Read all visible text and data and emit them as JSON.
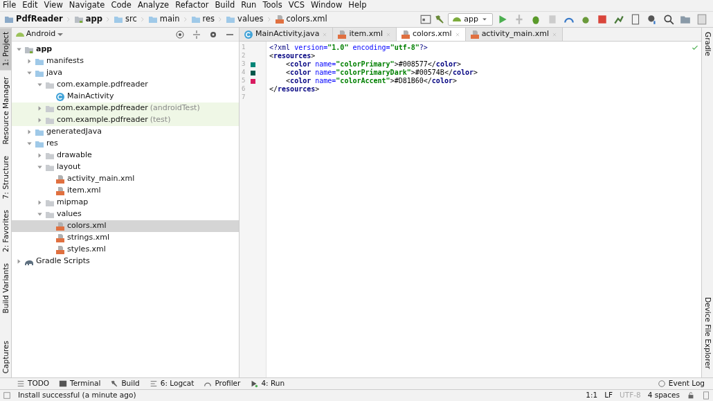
{
  "menu": [
    "File",
    "Edit",
    "View",
    "Navigate",
    "Code",
    "Analyze",
    "Refactor",
    "Build",
    "Run",
    "Tools",
    "VCS",
    "Window",
    "Help"
  ],
  "breadcrumb": [
    {
      "label": "PdfReader",
      "kind": "project"
    },
    {
      "label": "app",
      "kind": "module"
    },
    {
      "label": "src",
      "kind": "folder"
    },
    {
      "label": "main",
      "kind": "folder"
    },
    {
      "label": "res",
      "kind": "folder"
    },
    {
      "label": "values",
      "kind": "folder"
    },
    {
      "label": "colors.xml",
      "kind": "xml"
    }
  ],
  "run_config": "app",
  "left_stripe": [
    {
      "label": "1: Project",
      "selected": true
    },
    {
      "label": "Resource Manager",
      "selected": false
    },
    {
      "label": "7: Structure",
      "selected": false
    },
    {
      "label": "2: Favorites",
      "selected": false
    },
    {
      "label": "Build Variants",
      "selected": false
    },
    {
      "label": "Captures",
      "selected": false
    }
  ],
  "right_stripe": [
    {
      "label": "Gradle"
    },
    {
      "label": "Device File Explorer"
    }
  ],
  "project_panel": {
    "view": "Android",
    "tree": [
      {
        "label": "app",
        "kind": "module",
        "expanded": true,
        "selected": false,
        "children": [
          {
            "label": "manifests",
            "kind": "folder",
            "expanded": false,
            "selected": false
          },
          {
            "label": "java",
            "kind": "folder",
            "expanded": true,
            "selected": false,
            "children": [
              {
                "label": "com.example.pdfreader",
                "kind": "package",
                "expanded": true,
                "selected": false,
                "children": [
                  {
                    "label": "MainActivity",
                    "kind": "class",
                    "selected": false
                  }
                ]
              },
              {
                "label": "com.example.pdfreader",
                "suffix": "(androidTest)",
                "kind": "package",
                "test": true,
                "expanded": false,
                "selected": false
              },
              {
                "label": "com.example.pdfreader",
                "suffix": "(test)",
                "kind": "package",
                "test": true,
                "expanded": false,
                "selected": false
              }
            ]
          },
          {
            "label": "generatedJava",
            "kind": "folder",
            "expanded": false,
            "selected": false
          },
          {
            "label": "res",
            "kind": "folder",
            "expanded": true,
            "selected": false,
            "children": [
              {
                "label": "drawable",
                "kind": "package",
                "expanded": false,
                "selected": false
              },
              {
                "label": "layout",
                "kind": "package",
                "expanded": true,
                "selected": false,
                "children": [
                  {
                    "label": "activity_main.xml",
                    "kind": "xml",
                    "selected": false
                  },
                  {
                    "label": "item.xml",
                    "kind": "xml",
                    "selected": false
                  }
                ]
              },
              {
                "label": "mipmap",
                "kind": "package",
                "expanded": false,
                "selected": false
              },
              {
                "label": "values",
                "kind": "package",
                "expanded": true,
                "selected": false,
                "children": [
                  {
                    "label": "colors.xml",
                    "kind": "xml",
                    "selected": true
                  },
                  {
                    "label": "strings.xml",
                    "kind": "xml",
                    "selected": false
                  },
                  {
                    "label": "styles.xml",
                    "kind": "xml",
                    "selected": false
                  }
                ]
              }
            ]
          }
        ]
      },
      {
        "label": "Gradle Scripts",
        "kind": "gradle",
        "expanded": false,
        "selected": false
      }
    ]
  },
  "editor_tabs": [
    {
      "label": "MainActivity.java",
      "kind": "class",
      "selected": false
    },
    {
      "label": "item.xml",
      "kind": "xml",
      "selected": false
    },
    {
      "label": "colors.xml",
      "kind": "xml",
      "selected": true
    },
    {
      "label": "activity_main.xml",
      "kind": "xml",
      "selected": false
    }
  ],
  "code_lines": [
    {
      "number": "1",
      "tokens": [
        {
          "text": "<?xml ",
          "kind": "pi"
        },
        {
          "text": "version=",
          "kind": "attr"
        },
        {
          "text": "\"1.0\"",
          "kind": "value"
        },
        {
          "text": " encoding=",
          "kind": "attr"
        },
        {
          "text": "\"utf-8\"",
          "kind": "value"
        },
        {
          "text": "?>",
          "kind": "pi"
        }
      ]
    },
    {
      "number": "2",
      "tokens": [
        {
          "text": "<",
          "kind": "text"
        },
        {
          "text": "resources",
          "kind": "tag"
        },
        {
          "text": ">",
          "kind": "text"
        }
      ]
    },
    {
      "number": "3",
      "color": "#008577",
      "tokens": [
        {
          "text": "    <",
          "kind": "text"
        },
        {
          "text": "color ",
          "kind": "tag"
        },
        {
          "text": "name=",
          "kind": "attr"
        },
        {
          "text": "\"colorPrimary\"",
          "kind": "value"
        },
        {
          "text": ">#008577</",
          "kind": "text"
        },
        {
          "text": "color",
          "kind": "tag"
        },
        {
          "text": ">",
          "kind": "text"
        }
      ]
    },
    {
      "number": "4",
      "color": "#00574b",
      "tokens": [
        {
          "text": "    <",
          "kind": "text"
        },
        {
          "text": "color ",
          "kind": "tag"
        },
        {
          "text": "name=",
          "kind": "attr"
        },
        {
          "text": "\"colorPrimaryDark\"",
          "kind": "value"
        },
        {
          "text": ">#00574B</",
          "kind": "text"
        },
        {
          "text": "color",
          "kind": "tag"
        },
        {
          "text": ">",
          "kind": "text"
        }
      ]
    },
    {
      "number": "5",
      "color": "#d81b60",
      "tokens": [
        {
          "text": "    <",
          "kind": "text"
        },
        {
          "text": "color ",
          "kind": "tag"
        },
        {
          "text": "name=",
          "kind": "attr"
        },
        {
          "text": "\"colorAccent\"",
          "kind": "value"
        },
        {
          "text": ">#D81B60</",
          "kind": "text"
        },
        {
          "text": "color",
          "kind": "tag"
        },
        {
          "text": ">",
          "kind": "text"
        }
      ]
    },
    {
      "number": "6",
      "tokens": [
        {
          "text": "</",
          "kind": "text"
        },
        {
          "text": "resources",
          "kind": "tag"
        },
        {
          "text": ">",
          "kind": "text"
        }
      ]
    },
    {
      "number": "7"
    }
  ],
  "tool_windows": [
    {
      "label": "TODO",
      "kind": "todo"
    },
    {
      "label": "Terminal",
      "kind": "terminal"
    },
    {
      "label": "Build",
      "kind": "build"
    },
    {
      "label": "6: Logcat",
      "kind": "logcat"
    },
    {
      "label": "Profiler",
      "kind": "profiler"
    },
    {
      "label": "4: Run",
      "kind": "run"
    }
  ],
  "event_log": "Event Log",
  "status_bar": {
    "message": "Install successful (a minute ago)",
    "position": "1:1",
    "line_separator": "LF",
    "encoding": {
      "label": "UTF-8",
      "disabled": true
    },
    "indent": "4 spaces"
  }
}
